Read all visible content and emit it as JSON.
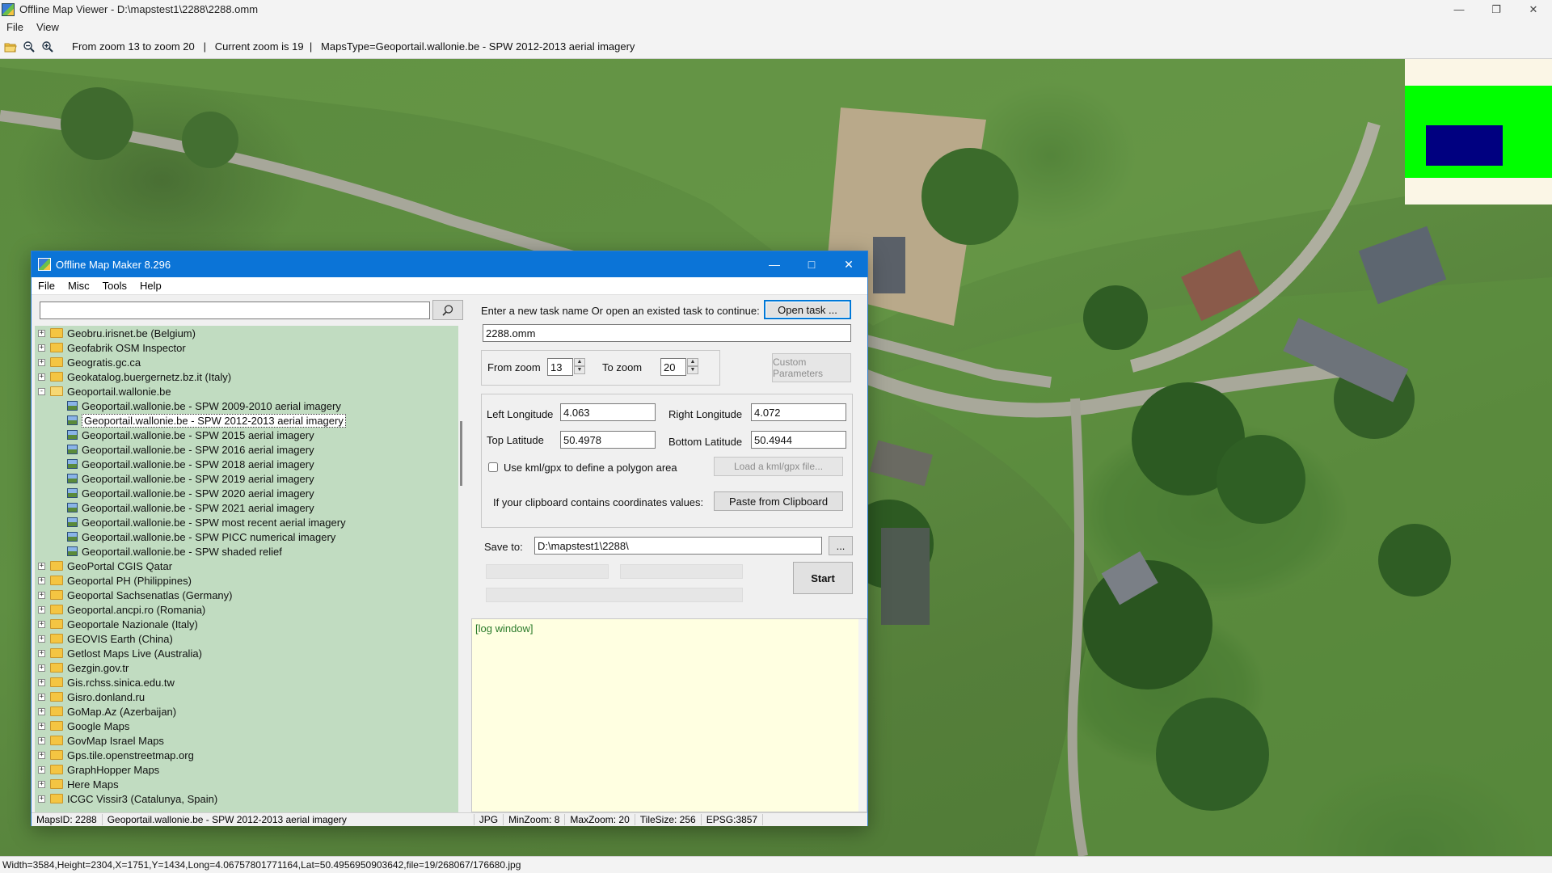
{
  "viewer": {
    "title": "Offline Map Viewer - D:\\mapstest1\\2288\\2288.omm",
    "menu": [
      "File",
      "View"
    ],
    "toolbar": {
      "icons": [
        "open-folder-icon",
        "zoom-out-icon",
        "zoom-in-icon"
      ],
      "info": "From zoom 13 to zoom 20   |   Current zoom is 19  |   MapsType=Geoportail.wallonie.be - SPW 2012-2013 aerial imagery"
    },
    "status": "Width=3584,Height=2304,X=1751,Y=1434,Long=4.06757801771164,Lat=50.4956950903642,file=19/268067/176680.jpg"
  },
  "maker": {
    "title": "Offline Map Maker 8.296",
    "menu": [
      "File",
      "Misc",
      "Tools",
      "Help"
    ],
    "search": {
      "value": "",
      "placeholder": ""
    },
    "tree": [
      {
        "label": "Geobru.irisnet.be (Belgium)",
        "type": "folder"
      },
      {
        "label": "Geofabrik OSM Inspector",
        "type": "folder"
      },
      {
        "label": "Geogratis.gc.ca",
        "type": "folder"
      },
      {
        "label": "Geokatalog.buergernetz.bz.it (Italy)",
        "type": "folder"
      },
      {
        "label": "Geoportail.wallonie.be",
        "type": "open-folder"
      },
      {
        "label": "Geoportail.wallonie.be - SPW 2009-2010 aerial imagery",
        "type": "map"
      },
      {
        "label": "Geoportail.wallonie.be - SPW 2012-2013 aerial imagery",
        "type": "map",
        "selected": true
      },
      {
        "label": "Geoportail.wallonie.be - SPW 2015 aerial imagery",
        "type": "map"
      },
      {
        "label": "Geoportail.wallonie.be - SPW 2016 aerial imagery",
        "type": "map"
      },
      {
        "label": "Geoportail.wallonie.be - SPW 2018 aerial imagery",
        "type": "map"
      },
      {
        "label": "Geoportail.wallonie.be - SPW 2019 aerial imagery",
        "type": "map"
      },
      {
        "label": "Geoportail.wallonie.be - SPW 2020 aerial imagery",
        "type": "map"
      },
      {
        "label": "Geoportail.wallonie.be - SPW 2021 aerial imagery",
        "type": "map"
      },
      {
        "label": "Geoportail.wallonie.be - SPW most recent aerial imagery",
        "type": "map"
      },
      {
        "label": "Geoportail.wallonie.be - SPW PICC numerical imagery",
        "type": "map"
      },
      {
        "label": "Geoportail.wallonie.be - SPW shaded relief",
        "type": "map"
      },
      {
        "label": "GeoPortal CGIS Qatar",
        "type": "folder"
      },
      {
        "label": "Geoportal PH (Philippines)",
        "type": "folder"
      },
      {
        "label": "Geoportal Sachsenatlas (Germany)",
        "type": "folder"
      },
      {
        "label": "Geoportal.ancpi.ro (Romania)",
        "type": "folder"
      },
      {
        "label": "Geoportale Nazionale (Italy)",
        "type": "folder"
      },
      {
        "label": "GEOVIS Earth (China)",
        "type": "folder"
      },
      {
        "label": "Getlost Maps Live (Australia)",
        "type": "folder"
      },
      {
        "label": "Gezgin.gov.tr",
        "type": "folder"
      },
      {
        "label": "Gis.rchss.sinica.edu.tw",
        "type": "folder"
      },
      {
        "label": "Gisro.donland.ru",
        "type": "folder"
      },
      {
        "label": "GoMap.Az (Azerbaijan)",
        "type": "folder"
      },
      {
        "label": "Google Maps",
        "type": "folder"
      },
      {
        "label": "GovMap Israel Maps",
        "type": "folder"
      },
      {
        "label": "Gps.tile.openstreetmap.org",
        "type": "folder"
      },
      {
        "label": "GraphHopper Maps",
        "type": "folder"
      },
      {
        "label": "Here Maps",
        "type": "folder"
      },
      {
        "label": "ICGC Vissir3 (Catalunya, Spain)",
        "type": "folder"
      }
    ],
    "task": {
      "prompt": "Enter a new task name Or open an existed task to continue:",
      "open_label": "Open task ...",
      "name": "2288.omm"
    },
    "zoom": {
      "from_label": "From zoom",
      "from_value": "13",
      "to_label": "To zoom",
      "to_value": "20",
      "custom_label": "Custom Parameters"
    },
    "coords": {
      "left_lon_label": "Left Longitude",
      "left_lon": "4.063",
      "right_lon_label": "Right Longitude",
      "right_lon": "4.072",
      "top_lat_label": "Top Latitude",
      "top_lat": "50.4978",
      "bottom_lat_label": "Bottom Latitude",
      "bottom_lat": "50.4944",
      "kml_label": "Use kml/gpx to define a polygon area",
      "kml_checked": false,
      "load_kml_label": "Load a kml/gpx file...",
      "clipboard_prompt": "If your clipboard contains coordinates values:",
      "paste_label": "Paste from Clipboard"
    },
    "save": {
      "label": "Save to:",
      "path": "D:\\mapstest1\\2288\\",
      "browse_label": "..."
    },
    "start_label": "Start",
    "log": "[log window]",
    "status": {
      "maps_id": "MapsID: 2288",
      "maps_name": "Geoportail.wallonie.be - SPW 2012-2013 aerial imagery",
      "format": "JPG",
      "min_zoom": "MinZoom: 8",
      "max_zoom": "MaxZoom: 20",
      "tile_size": "TileSize: 256",
      "epsg": "EPSG:3857"
    }
  },
  "colors": {
    "maker_titlebar": "#0b74d7",
    "tree_bg": "#c1dcc1",
    "log_bg": "#ffffe1",
    "overview_green": "#00ff00",
    "overview_blue": "#000080"
  }
}
